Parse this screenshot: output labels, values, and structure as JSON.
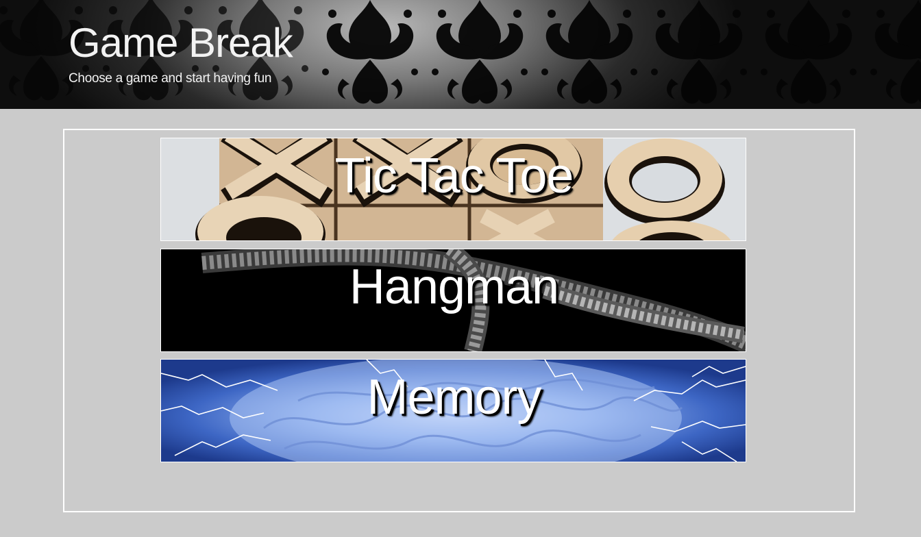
{
  "header": {
    "title": "Game Break",
    "subtitle": "Choose a game and start having fun"
  },
  "games": [
    {
      "label": "Tic Tac Toe",
      "image": "wooden-tic-tac-toe-board"
    },
    {
      "label": "Hangman",
      "image": "hanging-rope-noose"
    },
    {
      "label": "Memory",
      "image": "electric-brain"
    }
  ],
  "colors": {
    "page_background": "#cbcbcb",
    "border": "#ffffff",
    "label_text": "#ffffff"
  }
}
